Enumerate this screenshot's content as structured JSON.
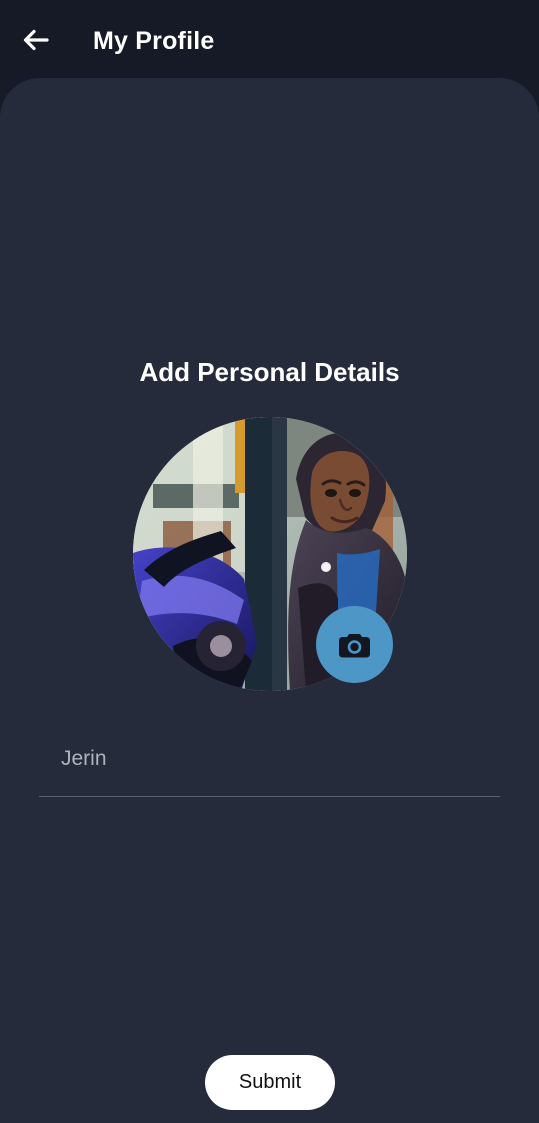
{
  "app_bar": {
    "title": "My Profile",
    "back_icon": "arrow-left-icon"
  },
  "main": {
    "heading": "Add Personal Details",
    "avatar": {
      "camera_icon": "camera-icon"
    },
    "name_field": {
      "value": "Jerin"
    },
    "submit_label": "Submit"
  },
  "colors": {
    "app_bar_background": "#151a26",
    "card_background": "#252b3b",
    "camera_button": "#4d97c7",
    "submit_button": "#ffffff",
    "text_primary": "#ffffff",
    "field_text": "#aeb2bd"
  }
}
